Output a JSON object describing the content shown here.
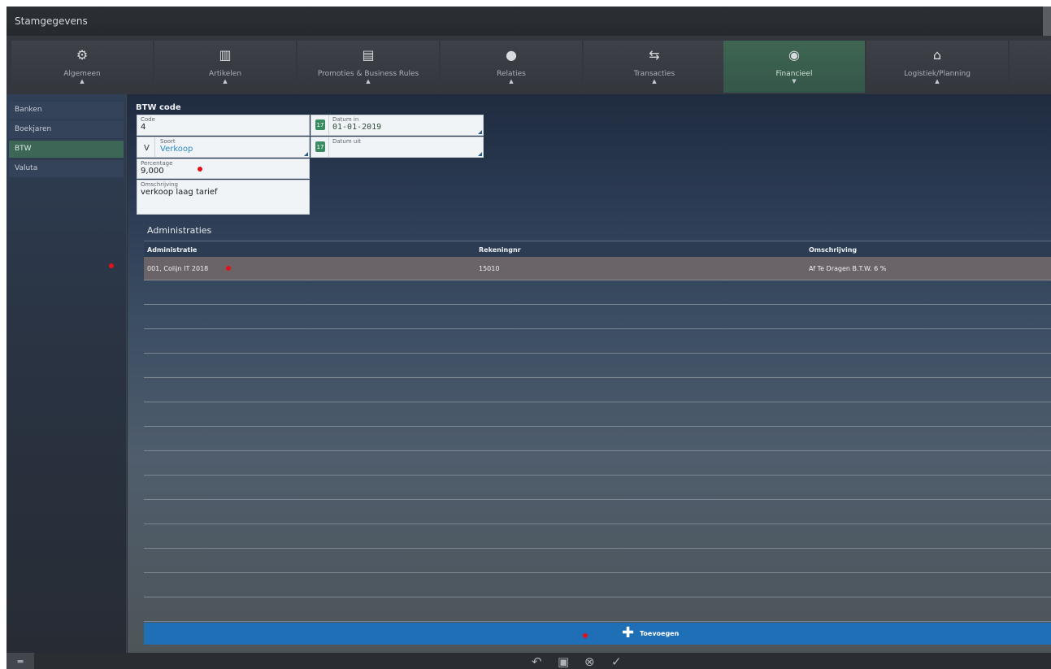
{
  "window": {
    "title": "Stamgegevens"
  },
  "nav": {
    "tiles": [
      {
        "label": "Algemeen",
        "icon": "gears-icon"
      },
      {
        "label": "Artikelen",
        "icon": "barcode-icon"
      },
      {
        "label": "Promoties & Business Rules",
        "icon": "promotion-icon"
      },
      {
        "label": "Relaties",
        "icon": "person-icon"
      },
      {
        "label": "Transacties",
        "icon": "transfer-arrows-icon"
      },
      {
        "label": "Financieel",
        "icon": "finance-icon",
        "active": true
      },
      {
        "label": "Logistiek/Planning",
        "icon": "warehouse-icon"
      }
    ]
  },
  "sidebar": {
    "items": [
      {
        "label": "Banken"
      },
      {
        "label": "Boekjaren"
      },
      {
        "label": "BTW",
        "active": true
      },
      {
        "label": "Valuta"
      }
    ]
  },
  "form": {
    "title": "BTW code",
    "code": {
      "label": "Code",
      "value": "4"
    },
    "soort": {
      "prefix": "V",
      "label": "Soort",
      "value": "Verkoop"
    },
    "percentage": {
      "label": "Percentage",
      "value": "9,000"
    },
    "omschrijving": {
      "label": "Omschrijving",
      "value": "verkoop laag tarief"
    },
    "datum_in": {
      "label": "Datum in",
      "value": "01-01-2019"
    },
    "datum_uit": {
      "label": "Datum uit",
      "value": ""
    }
  },
  "administraties": {
    "title": "Administraties",
    "columns": [
      "Administratie",
      "Rekeningnr",
      "Omschrijving"
    ],
    "rows": [
      {
        "administratie": "001, Colijn IT 2018",
        "rekeningnr": "15010",
        "omschrijving": "Af Te Dragen B.T.W. 6 %"
      }
    ],
    "add_label": "Toevoegen"
  },
  "toolbar": {
    "buttons": [
      "undo-icon",
      "save-icon",
      "cancel-icon",
      "confirm-icon",
      "cart-icon"
    ]
  },
  "colors": {
    "accent_active": "#3d6657",
    "add_bar": "#1f6fb6",
    "marker": "#e0121a"
  }
}
